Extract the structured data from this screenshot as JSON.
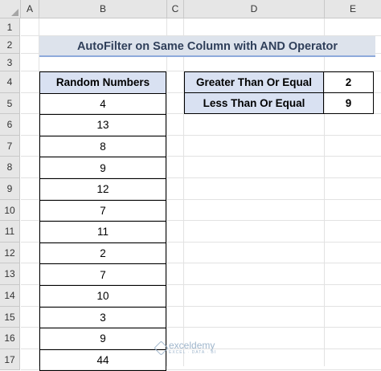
{
  "columns": [
    "A",
    "B",
    "C",
    "D",
    "E"
  ],
  "rows": [
    "1",
    "2",
    "3",
    "4",
    "5",
    "6",
    "7",
    "8",
    "9",
    "10",
    "11",
    "12",
    "13",
    "14",
    "15",
    "16",
    "17"
  ],
  "title": "AutoFilter on Same Column with AND Operator",
  "random_table": {
    "header": "Random Numbers",
    "values": [
      "4",
      "13",
      "8",
      "9",
      "12",
      "7",
      "11",
      "2",
      "7",
      "10",
      "3",
      "9",
      "44"
    ]
  },
  "criteria": [
    {
      "label": "Greater Than Or Equal",
      "value": "2"
    },
    {
      "label": "Less Than Or Equal",
      "value": "9"
    }
  ],
  "watermark": {
    "name": "exceldemy",
    "tagline": "EXCEL · DATA · BI",
    "icon": "exceldemy-logo-icon"
  }
}
